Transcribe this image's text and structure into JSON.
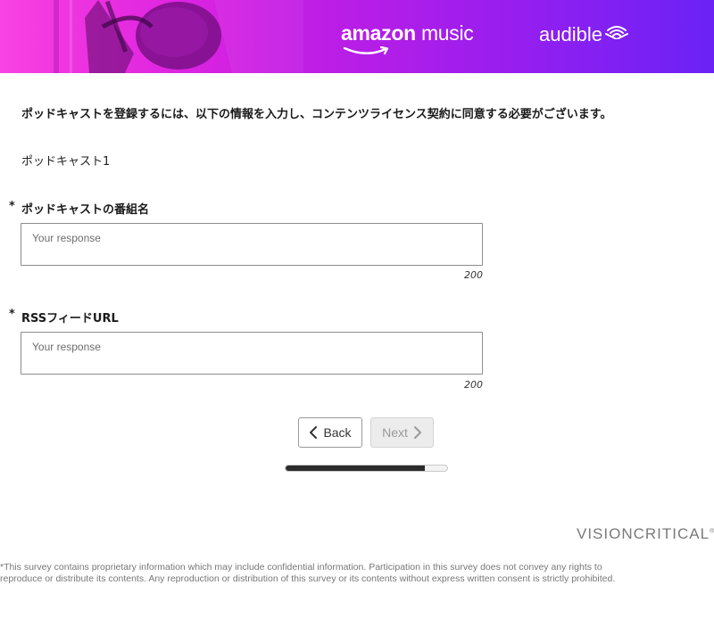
{
  "banner": {
    "brand_amazon_main": "amazon",
    "brand_amazon_sub": "music",
    "brand_audible": "audible",
    "gradient_colors": [
      "#f021d8",
      "#b01ee8",
      "#6a22f5"
    ]
  },
  "intro_text": "ポッドキャストを登録するには、以下の情報を入力し、コンテンツライセンス契約に同意する必要がございます。",
  "section_label": "ポッドキャスト1",
  "questions": [
    {
      "required_mark": "*",
      "label": "ポッドキャストの番組名",
      "placeholder": "Your response",
      "value": "",
      "char_limit": "200"
    },
    {
      "required_mark": "*",
      "label": "RSSフィードURL",
      "placeholder": "Your response",
      "value": "",
      "char_limit": "200"
    }
  ],
  "nav": {
    "back_label": "Back",
    "next_label": "Next",
    "back_icon": "chevron-left-icon",
    "next_icon": "chevron-right-icon"
  },
  "progress": {
    "fraction": 0.86
  },
  "footer": {
    "logo_text": "VISIONCRITICAL",
    "logo_mark": "®",
    "disclaimer": "*This survey contains proprietary information which may include confidential information. Participation in this survey does not convey any rights to reproduce or distribute its contents. Any reproduction or distribution of this survey or its contents without express written consent is strictly prohibited."
  }
}
